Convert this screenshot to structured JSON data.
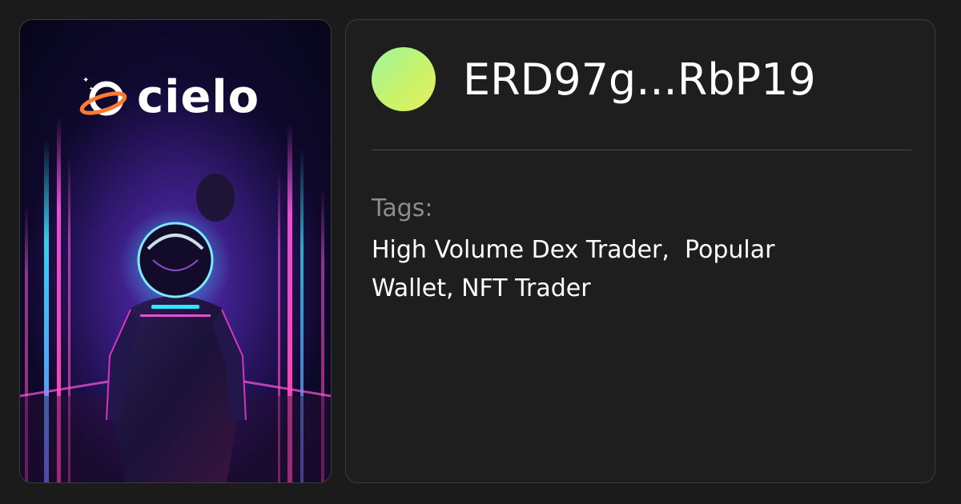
{
  "brand": {
    "name": "cielo",
    "logo_icon": "planet-ring-logo-icon"
  },
  "artwork": {
    "subject": "astronaut-illustration"
  },
  "wallet": {
    "address": "ERD97g...RbP19",
    "avatar_gradient": [
      "#9df7a0",
      "#e6ef5e"
    ]
  },
  "tags": {
    "label": "Tags:",
    "values_text": "High Volume Dex Trader,  Popular\nWallet, NFT Trader"
  },
  "colors": {
    "background": "#1b1b1b",
    "card_border": "#3c3c3c",
    "text_primary": "#ffffff",
    "text_muted": "#8c8c8c",
    "neon_pink": "#ff3fd8",
    "neon_cyan": "#2fe8ff"
  }
}
